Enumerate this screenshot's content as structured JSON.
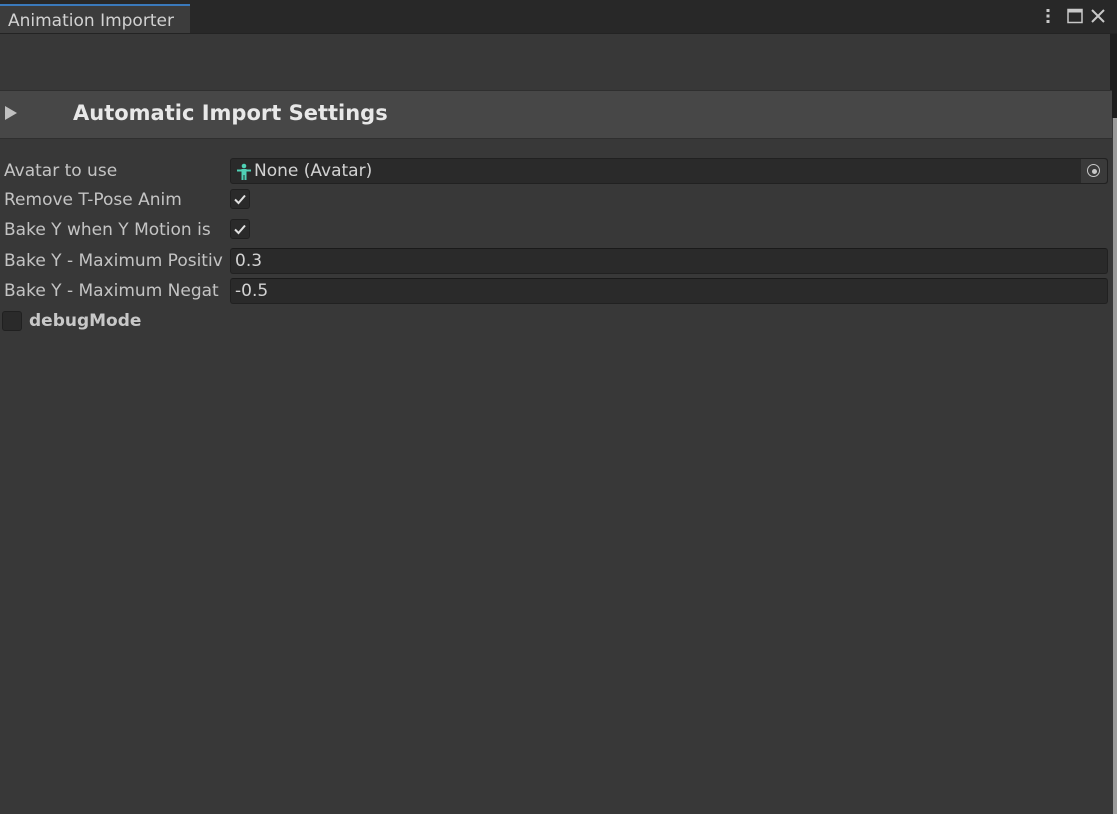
{
  "window": {
    "tab_title": "Animation Importer",
    "buttons": [
      "more-options",
      "maximize",
      "close"
    ]
  },
  "section": {
    "title": "Automatic Import Settings",
    "expanded": false
  },
  "fields": {
    "avatar": {
      "label": "Avatar to use",
      "value": "None (Avatar)"
    },
    "remove_tpose": {
      "label": "Remove T-Pose Anim",
      "checked": true
    },
    "bake_y_motion": {
      "label": "Bake Y when Y Motion is",
      "checked": true
    },
    "bake_y_max_pos": {
      "label": "Bake Y - Maximum Positiv",
      "value": "0.3"
    },
    "bake_y_max_neg": {
      "label": "Bake Y - Maximum Negat",
      "value": "-0.5"
    },
    "debug_mode": {
      "label": "debugMode",
      "checked": false
    }
  },
  "colors": {
    "tab_accent": "#3a79bb",
    "avatar_icon": "#4fd1b5"
  }
}
